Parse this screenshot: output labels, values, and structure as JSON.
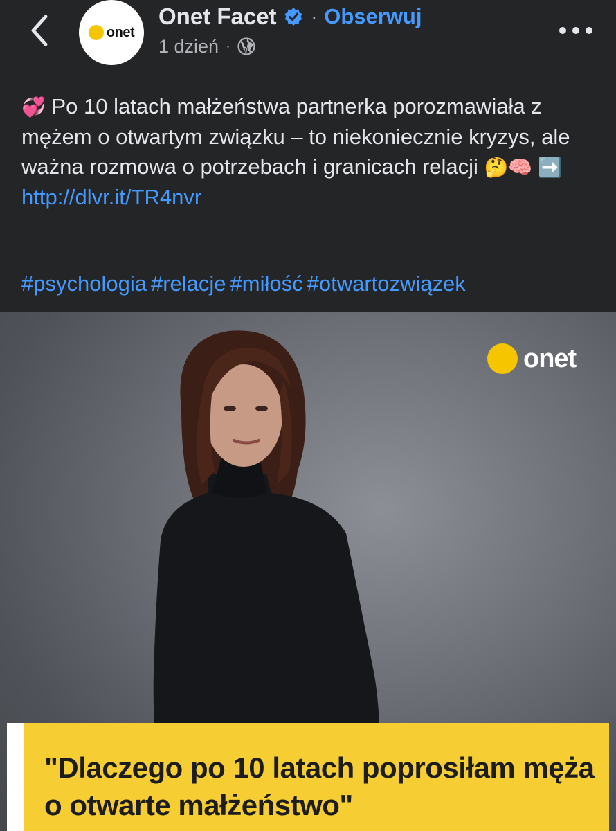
{
  "header": {
    "back_icon": "chevron-left-icon",
    "avatar_text": "onet",
    "page_name": "Onet Facet",
    "verified_icon": "verified-badge-icon",
    "separator": "·",
    "follow_label": "Obserwuj",
    "time": "1 dzień",
    "meta_separator": "·",
    "privacy_icon": "globe-icon",
    "more_icon": "more-horizontal-icon"
  },
  "post": {
    "lead_emoji": "💞",
    "text": "Po 10 latach małżeństwa partnerka porozmawiała z mężem o otwartym związku – to niekoniecznie kryzys, ale ważna rozmowa o potrzebach i granicach relacji",
    "trail_emojis": "🤔🧠 ➡️",
    "link": "http://dlvr.it/TR4nvr",
    "hashtags": [
      "#psychologia",
      "#relacje",
      "#miłość",
      "#otwartozwiązek"
    ]
  },
  "image": {
    "logo_text": "onet",
    "headline": "\"Dlaczego po 10 latach poprosiłam męża o otwarte małżeństwo\""
  },
  "colors": {
    "background": "#242526",
    "link": "#4599ff",
    "accent_yellow": "#f5c600",
    "headline_box": "#f6cd33"
  }
}
